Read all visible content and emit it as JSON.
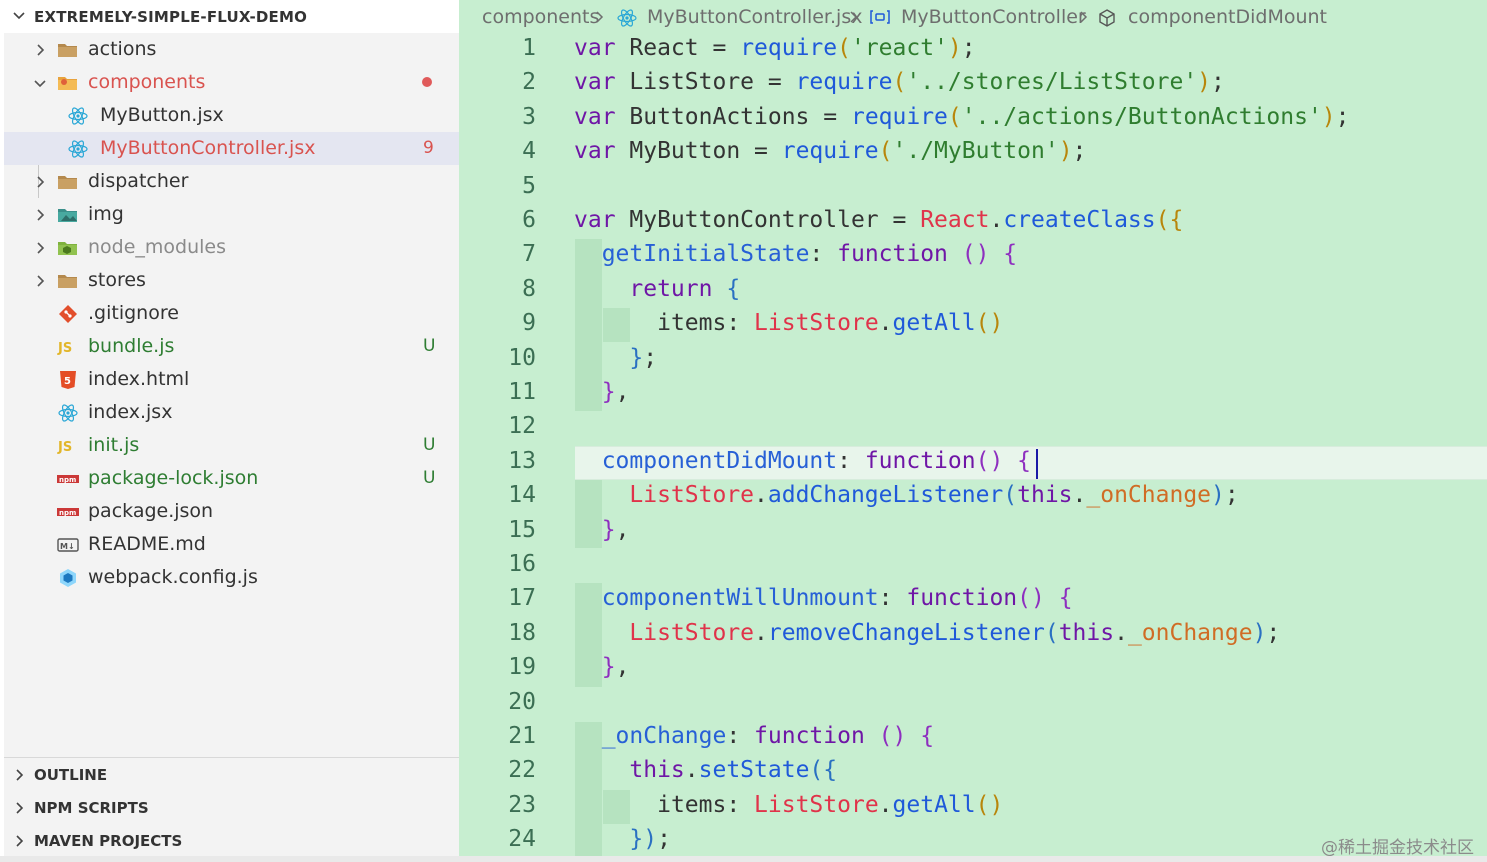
{
  "explorer": {
    "root_title": "EXTREMELY-SIMPLE-FLUX-DEMO",
    "items": [
      {
        "label": "actions",
        "kind": "folder",
        "depth": 0,
        "expanded": false,
        "color": "#333333",
        "badge": ""
      },
      {
        "label": "components",
        "kind": "folder-components",
        "depth": 0,
        "expanded": true,
        "color": "#d9534f",
        "badge": "dot"
      },
      {
        "label": "MyButton.jsx",
        "kind": "react",
        "depth": 1,
        "color": "#333333",
        "badge": ""
      },
      {
        "label": "MyButtonController.jsx",
        "kind": "react",
        "depth": 1,
        "color": "#d9534f",
        "badge": "9",
        "selected": true
      },
      {
        "label": "dispatcher",
        "kind": "folder",
        "depth": 0,
        "expanded": false,
        "color": "#333333",
        "badge": ""
      },
      {
        "label": "img",
        "kind": "folder-img",
        "depth": 0,
        "expanded": false,
        "color": "#333333",
        "badge": ""
      },
      {
        "label": "node_modules",
        "kind": "folder-node",
        "depth": 0,
        "expanded": false,
        "color": "#8a8a8a",
        "badge": ""
      },
      {
        "label": "stores",
        "kind": "folder",
        "depth": 0,
        "expanded": false,
        "color": "#333333",
        "badge": ""
      },
      {
        "label": ".gitignore",
        "kind": "git",
        "depth": 0,
        "color": "#333333",
        "badge": ""
      },
      {
        "label": "bundle.js",
        "kind": "js",
        "depth": 0,
        "color": "#2e7d32",
        "badge": "U"
      },
      {
        "label": "index.html",
        "kind": "html",
        "depth": 0,
        "color": "#333333",
        "badge": ""
      },
      {
        "label": "index.jsx",
        "kind": "react",
        "depth": 0,
        "color": "#333333",
        "badge": ""
      },
      {
        "label": "init.js",
        "kind": "js",
        "depth": 0,
        "color": "#2e7d32",
        "badge": "U"
      },
      {
        "label": "package-lock.json",
        "kind": "npm",
        "depth": 0,
        "color": "#2e7d32",
        "badge": "U"
      },
      {
        "label": "package.json",
        "kind": "npm",
        "depth": 0,
        "color": "#333333",
        "badge": ""
      },
      {
        "label": "README.md",
        "kind": "md",
        "depth": 0,
        "color": "#333333",
        "badge": ""
      },
      {
        "label": "webpack.config.js",
        "kind": "webpack",
        "depth": 0,
        "color": "#333333",
        "badge": ""
      }
    ],
    "sections": [
      "OUTLINE",
      "NPM SCRIPTS",
      "MAVEN PROJECTS"
    ]
  },
  "icons": {
    "react_icon_text": "",
    "js_icon_text": "JS",
    "npm_icon_text": "npm",
    "md_icon_text": "M↓",
    "html_icon_text": "5"
  },
  "breadcrumb": {
    "items": [
      "components",
      "MyButtonController.jsx",
      "MyButtonController",
      "componentDidMount"
    ]
  },
  "code": {
    "lines": [
      [
        [
          "kw",
          "var "
        ],
        [
          "id",
          "React "
        ],
        [
          "pun",
          "= "
        ],
        [
          "fn",
          "require"
        ],
        [
          "br1",
          "("
        ],
        [
          "str",
          "'react'"
        ],
        [
          "br1",
          ")"
        ],
        [
          "pun",
          ";"
        ]
      ],
      [
        [
          "kw",
          "var "
        ],
        [
          "id",
          "ListStore "
        ],
        [
          "pun",
          "= "
        ],
        [
          "fn",
          "require"
        ],
        [
          "br1",
          "("
        ],
        [
          "str",
          "'../stores/ListStore'"
        ],
        [
          "br1",
          ")"
        ],
        [
          "pun",
          ";"
        ]
      ],
      [
        [
          "kw",
          "var "
        ],
        [
          "id",
          "ButtonActions "
        ],
        [
          "pun",
          "= "
        ],
        [
          "fn",
          "require"
        ],
        [
          "br1",
          "("
        ],
        [
          "str",
          "'../actions/ButtonActions'"
        ],
        [
          "br1",
          ")"
        ],
        [
          "pun",
          ";"
        ]
      ],
      [
        [
          "kw",
          "var "
        ],
        [
          "id",
          "MyButton "
        ],
        [
          "pun",
          "= "
        ],
        [
          "fn",
          "require"
        ],
        [
          "br1",
          "("
        ],
        [
          "str",
          "'./MyButton'"
        ],
        [
          "br1",
          ")"
        ],
        [
          "pun",
          ";"
        ]
      ],
      [],
      [
        [
          "kw",
          "var "
        ],
        [
          "id",
          "MyButtonController "
        ],
        [
          "pun",
          "= "
        ],
        [
          "obj",
          "React"
        ],
        [
          "pun",
          "."
        ],
        [
          "fn",
          "createClass"
        ],
        [
          "br1",
          "({"
        ]
      ],
      [
        [
          "pun",
          "  "
        ],
        [
          "prop",
          "getInitialState"
        ],
        [
          "pun",
          ": "
        ],
        [
          "kw",
          "function "
        ],
        [
          "br2",
          "() "
        ],
        [
          "br2",
          "{"
        ]
      ],
      [
        [
          "pun",
          "    "
        ],
        [
          "kw",
          "return "
        ],
        [
          "br3",
          "{"
        ]
      ],
      [
        [
          "pun",
          "      "
        ],
        [
          "id",
          "items"
        ],
        [
          "pun",
          ": "
        ],
        [
          "obj",
          "ListStore"
        ],
        [
          "pun",
          "."
        ],
        [
          "fn",
          "getAll"
        ],
        [
          "br1",
          "()"
        ]
      ],
      [
        [
          "pun",
          "    "
        ],
        [
          "br3",
          "}"
        ],
        [
          "pun",
          ";"
        ]
      ],
      [
        [
          "pun",
          "  "
        ],
        [
          "br2",
          "}"
        ],
        [
          "pun",
          ","
        ]
      ],
      [],
      [
        [
          "pun",
          "  "
        ],
        [
          "prop",
          "componentDidMount"
        ],
        [
          "pun",
          ": "
        ],
        [
          "kw",
          "function"
        ],
        [
          "br2",
          "() "
        ],
        [
          "br2",
          "{"
        ]
      ],
      [
        [
          "pun",
          "    "
        ],
        [
          "obj",
          "ListStore"
        ],
        [
          "pun",
          "."
        ],
        [
          "fn",
          "addChangeListener"
        ],
        [
          "br3",
          "("
        ],
        [
          "kw",
          "this"
        ],
        [
          "pun",
          "."
        ],
        [
          "pr",
          "_onChange"
        ],
        [
          "br3",
          ")"
        ],
        [
          "pun",
          ";"
        ]
      ],
      [
        [
          "pun",
          "  "
        ],
        [
          "br2",
          "}"
        ],
        [
          "pun",
          ","
        ]
      ],
      [],
      [
        [
          "pun",
          "  "
        ],
        [
          "prop",
          "componentWillUnmount"
        ],
        [
          "pun",
          ": "
        ],
        [
          "kw",
          "function"
        ],
        [
          "br2",
          "() "
        ],
        [
          "br2",
          "{"
        ]
      ],
      [
        [
          "pun",
          "    "
        ],
        [
          "obj",
          "ListStore"
        ],
        [
          "pun",
          "."
        ],
        [
          "fn",
          "removeChangeListener"
        ],
        [
          "br3",
          "("
        ],
        [
          "kw",
          "this"
        ],
        [
          "pun",
          "."
        ],
        [
          "pr",
          "_onChange"
        ],
        [
          "br3",
          ")"
        ],
        [
          "pun",
          ";"
        ]
      ],
      [
        [
          "pun",
          "  "
        ],
        [
          "br2",
          "}"
        ],
        [
          "pun",
          ","
        ]
      ],
      [],
      [
        [
          "pun",
          "  "
        ],
        [
          "prop",
          "_onChange"
        ],
        [
          "pun",
          ": "
        ],
        [
          "kw",
          "function "
        ],
        [
          "br2",
          "() "
        ],
        [
          "br2",
          "{"
        ]
      ],
      [
        [
          "pun",
          "    "
        ],
        [
          "kw",
          "this"
        ],
        [
          "pun",
          "."
        ],
        [
          "fn",
          "setState"
        ],
        [
          "br3",
          "({"
        ]
      ],
      [
        [
          "pun",
          "      "
        ],
        [
          "id",
          "items"
        ],
        [
          "pun",
          ": "
        ],
        [
          "obj",
          "ListStore"
        ],
        [
          "pun",
          "."
        ],
        [
          "fn",
          "getAll"
        ],
        [
          "br1",
          "()"
        ]
      ],
      [
        [
          "pun",
          "    "
        ],
        [
          "br3",
          "})"
        ],
        [
          "pun",
          ";"
        ]
      ]
    ],
    "current_line": 13
  },
  "watermark": "@稀土掘金技术社区"
}
